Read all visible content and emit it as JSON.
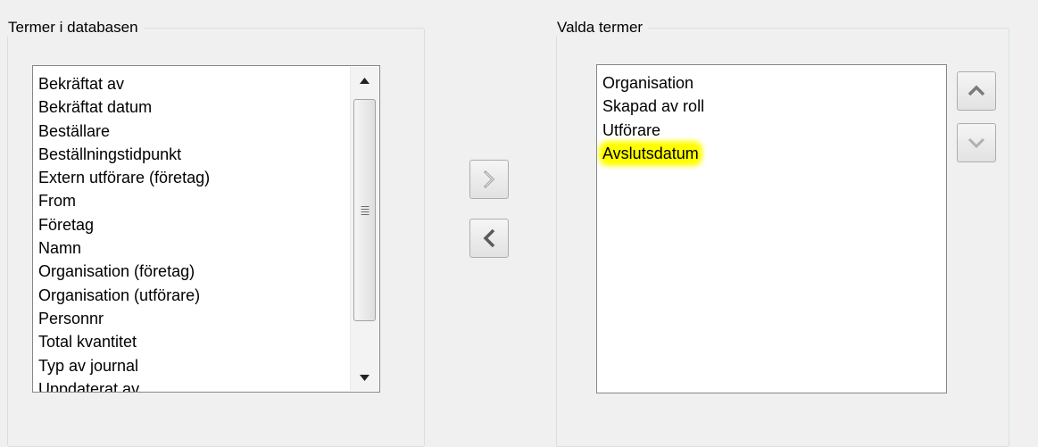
{
  "left_group": {
    "title": "Termer i databasen",
    "items": [
      "Bekräftat av",
      "Bekräftat datum",
      "Beställare",
      "Beställningstidpunkt",
      "Extern utförare (företag)",
      "From",
      "Företag",
      "Namn",
      "Organisation (företag)",
      "Organisation (utförare)",
      "Personnr",
      "Total kvantitet",
      "Typ av journal",
      "Uppdaterat av"
    ]
  },
  "right_group": {
    "title": "Valda termer",
    "items": [
      "Organisation",
      "Skapad av roll",
      "Utförare",
      "Avslutsdatum"
    ],
    "highlighted_item": "Avslutsdatum"
  },
  "buttons": {
    "add": "chevron-right-icon",
    "remove": "chevron-left-icon",
    "move_up": "chevron-up-icon",
    "move_down": "chevron-down-icon"
  },
  "colors": {
    "highlight": "#ffff00",
    "background": "#f0f0f0",
    "list_border": "#828790"
  }
}
